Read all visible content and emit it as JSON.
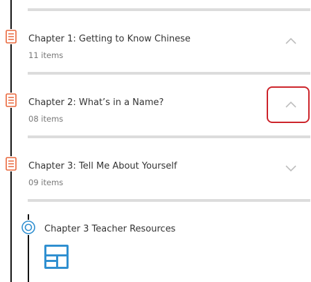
{
  "chapters": [
    {
      "title": "Chapter 1: Getting to Know Chinese",
      "count": "11 items",
      "icon": "document-icon",
      "chevron": "chevron-up-icon",
      "expanded": true
    },
    {
      "title": "Chapter 2: What’s in a Name?",
      "count": "08 items",
      "icon": "document-icon",
      "chevron": "chevron-up-icon",
      "expanded": true
    },
    {
      "title": "Chapter 3: Tell Me About Yourself",
      "count": "09 items",
      "icon": "document-icon",
      "chevron": "chevron-down-icon",
      "expanded": false
    }
  ],
  "resource": {
    "title": "Chapter 3 Teacher Resources",
    "icon": "resource-node-icon",
    "thumbnail_icon": "layout-template-icon"
  },
  "colors": {
    "accent": "#e9663a",
    "highlight": "#cc2229",
    "resource_blue": "#2f8fd0",
    "divider": "#dcdcdc"
  }
}
